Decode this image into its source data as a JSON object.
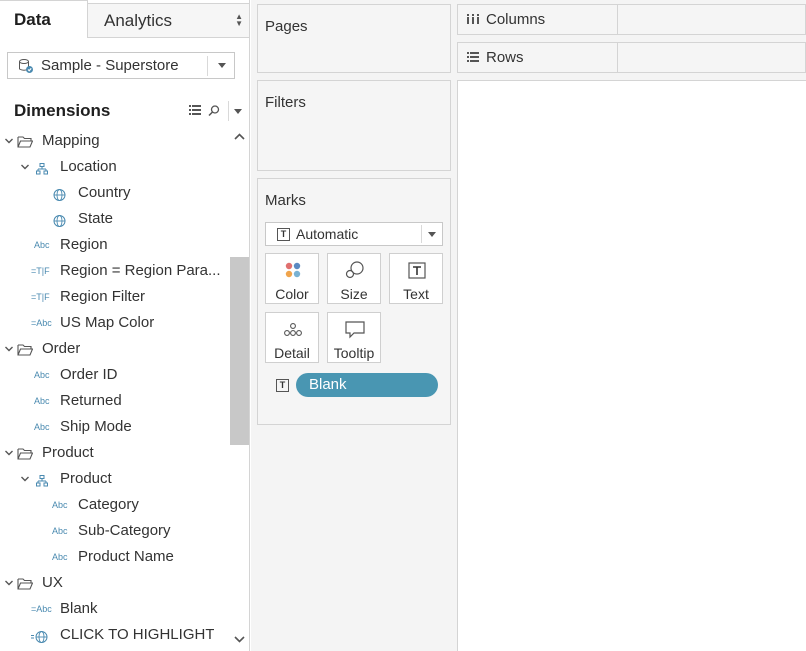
{
  "tabs": {
    "data": "Data",
    "analytics": "Analytics"
  },
  "datasource": {
    "label": "Sample - Superstore"
  },
  "dimensions": {
    "title": "Dimensions",
    "items": [
      {
        "label": "Mapping",
        "type": "folder",
        "level": 0,
        "expanded": true
      },
      {
        "label": "Location",
        "type": "hierarchy",
        "level": 1,
        "expanded": true
      },
      {
        "label": "Country",
        "type": "geo",
        "level": 2
      },
      {
        "label": "State",
        "type": "geo",
        "level": 2
      },
      {
        "label": "Region",
        "type": "string",
        "level": 1
      },
      {
        "label": "Region = Region Para...",
        "type": "calc-bool",
        "level": 1
      },
      {
        "label": "Region Filter",
        "type": "calc-bool",
        "level": 1
      },
      {
        "label": "US Map Color",
        "type": "calc-string",
        "level": 1
      },
      {
        "label": "Order",
        "type": "folder",
        "level": 0,
        "expanded": true
      },
      {
        "label": "Order ID",
        "type": "string",
        "level": 1
      },
      {
        "label": "Returned",
        "type": "string",
        "level": 1
      },
      {
        "label": "Ship Mode",
        "type": "string",
        "level": 1
      },
      {
        "label": "Product",
        "type": "folder",
        "level": 0,
        "expanded": true
      },
      {
        "label": "Product",
        "type": "hierarchy",
        "level": 1,
        "expanded": true
      },
      {
        "label": "Category",
        "type": "string",
        "level": 2
      },
      {
        "label": "Sub-Category",
        "type": "string",
        "level": 2
      },
      {
        "label": "Product Name",
        "type": "string",
        "level": 2
      },
      {
        "label": "UX",
        "type": "folder",
        "level": 0,
        "expanded": true
      },
      {
        "label": "Blank",
        "type": "calc-string",
        "level": 1
      },
      {
        "label": "CLICK TO HIGHLIGHT",
        "type": "calc-geo",
        "level": 1
      }
    ]
  },
  "cards": {
    "pages": "Pages",
    "filters": "Filters",
    "marks": {
      "title": "Marks",
      "mark_type": "Automatic",
      "buttons": {
        "color": "Color",
        "size": "Size",
        "text": "Text",
        "detail": "Detail",
        "tooltip": "Tooltip"
      },
      "pill": "Blank",
      "pill_color": "#4996b2"
    }
  },
  "shelves": {
    "columns": "Columns",
    "rows": "Rows"
  },
  "icons": {
    "abc_text": "Abc",
    "bool_text": "=T|F",
    "calc_abc_text": "=Abc",
    "text_mark": "T"
  }
}
